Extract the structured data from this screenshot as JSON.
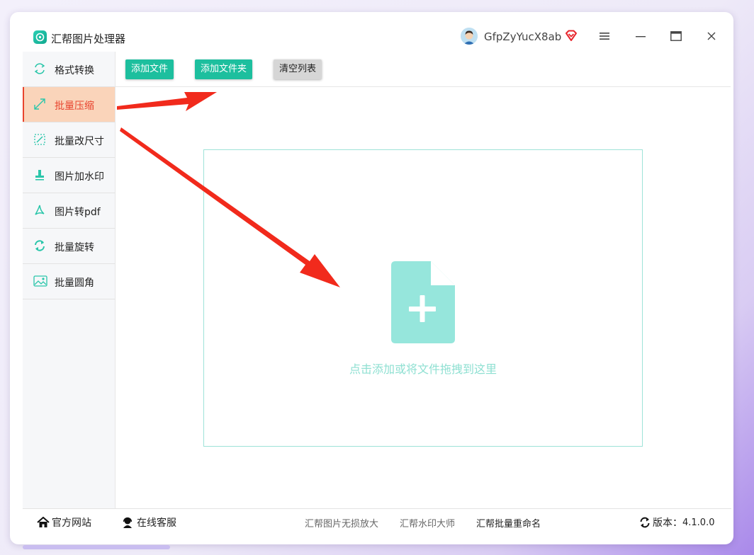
{
  "app": {
    "title": "汇帮图片处理器",
    "username": "GfpZyYucX8ab"
  },
  "sidebar": {
    "items": [
      {
        "label": "格式转换",
        "icon": "format-convert-icon"
      },
      {
        "label": "批量压缩",
        "icon": "compress-icon",
        "active": true
      },
      {
        "label": "批量改尺寸",
        "icon": "resize-icon"
      },
      {
        "label": "图片加水印",
        "icon": "watermark-stamp-icon"
      },
      {
        "label": "图片转pdf",
        "icon": "pdf-icon"
      },
      {
        "label": "批量旋转",
        "icon": "rotate-icon"
      },
      {
        "label": "批量圆角",
        "icon": "image-round-corner-icon"
      }
    ]
  },
  "toolbar": {
    "add_file": "添加文件",
    "add_folder": "添加文件夹",
    "clear_list": "清空列表"
  },
  "dropzone": {
    "hint": "点击添加或将文件拖拽到这里"
  },
  "footer": {
    "website": "官方网站",
    "support": "在线客服",
    "links": [
      "汇帮图片无损放大",
      "汇帮水印大师",
      "汇帮批量重命名"
    ],
    "version_label": "版本：",
    "version": "4.1.0.0"
  },
  "colors": {
    "accent": "#1dbf9e",
    "active_bg": "#fad4ba",
    "active_text": "#e8442e",
    "annotation_arrow": "#f12a1c",
    "drop_icon": "#96e6dc"
  }
}
